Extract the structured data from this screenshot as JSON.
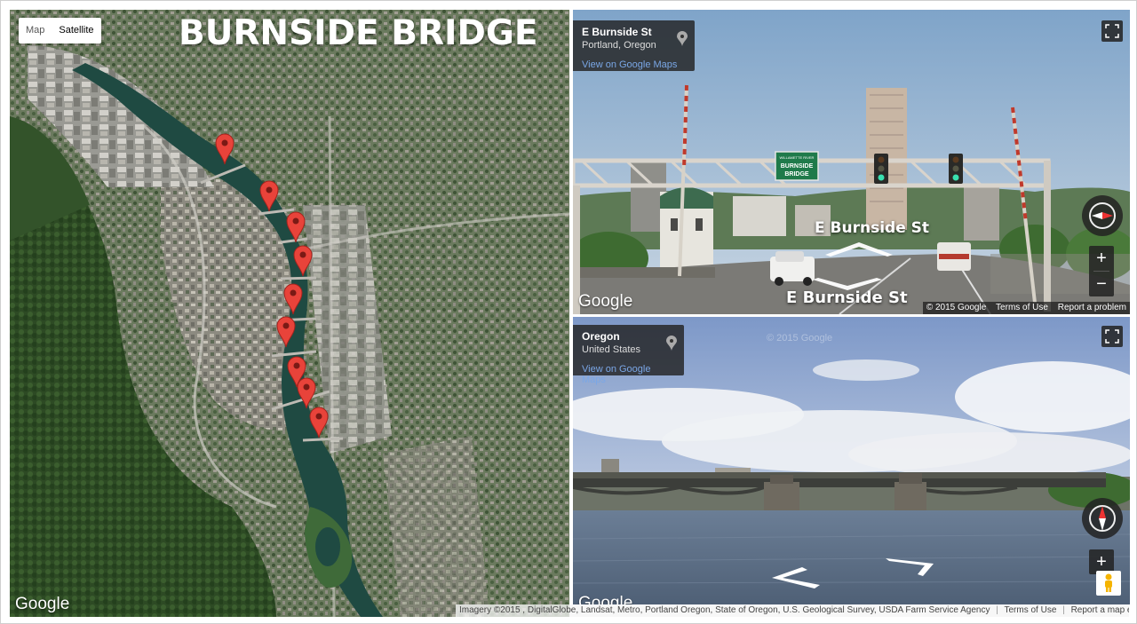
{
  "map": {
    "title": "BURNSIDE BRIDGE",
    "map_type": {
      "map_label": "Map",
      "satellite_label": "Satellite",
      "selected": "Satellite"
    },
    "google_logo": "Google",
    "attribution": {
      "imagery": "Imagery ©2015 , DigitalGlobe, Landsat, Metro, Portland Oregon, State of Oregon, U.S. Geological Survey, USDA Farm Service Agency",
      "terms": "Terms of Use",
      "report": "Report a map error"
    },
    "markers": [
      {
        "name": "marker-1"
      },
      {
        "name": "marker-2"
      },
      {
        "name": "marker-3"
      },
      {
        "name": "marker-4"
      },
      {
        "name": "marker-5"
      },
      {
        "name": "marker-6"
      },
      {
        "name": "marker-7"
      },
      {
        "name": "marker-8"
      },
      {
        "name": "marker-9"
      }
    ],
    "colors": {
      "marker": "#e8433a",
      "river": "#1f4a42",
      "forest": "#2d4a24"
    }
  },
  "street_view_top": {
    "street": "E Burnside St",
    "city": "Portland, Oregon",
    "view_link": "View on Google Maps",
    "nav_label_far": "E Burnside St",
    "nav_label_near": "E Burnside St",
    "sign_line1": "WILLAMETTE RIVER",
    "sign_line2": "BURNSIDE",
    "sign_line3": "BRIDGE",
    "google_logo": "Google",
    "copyright": "© 2015 Google",
    "terms": "Terms of Use",
    "report": "Report a problem",
    "zoom_in": "+",
    "zoom_out": "−"
  },
  "street_view_bottom": {
    "place": "Oregon",
    "country": "United States",
    "view_link": "View on Google Maps",
    "watermark": "© 2015 Google",
    "google_logo": "Google",
    "zoom_in": "+"
  }
}
